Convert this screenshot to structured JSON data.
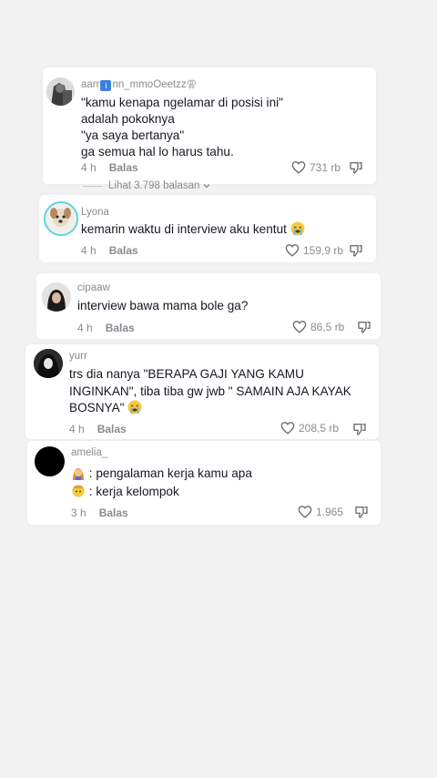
{
  "comments": [
    {
      "username": "aarr",
      "username_rest": "nn_mmoOeetzz",
      "lines": [
        "\"kamu kenapa ngelamar di posisi ini\"",
        "adalah pokoknya",
        "\"ya saya bertanya\"",
        "ga semua hal lo harus tahu."
      ],
      "time": "4 h",
      "reply": "Balas",
      "likes": "731 rb",
      "view_replies": "Lihat 3.798 balasan"
    },
    {
      "username": "Lyona",
      "text": "kemarin waktu di interview aku kentut",
      "time": "4 h",
      "reply": "Balas",
      "likes": "159,9 rb"
    },
    {
      "username": "cipaaw",
      "text": "interview bawa mama bole ga?",
      "time": "4 h",
      "reply": "Balas",
      "likes": "86,5 rb"
    },
    {
      "username": "yurr",
      "lines": [
        "trs dia nanya \"BERAPA GAJI YANG KAMU",
        "INGINKAN\", tiba tiba gw jwb \" SAMAIN AJA KAYAK",
        "BOSNYA\""
      ],
      "time": "4 h",
      "reply": "Balas",
      "likes": "208,5 rb"
    },
    {
      "username": "amelia_",
      "lines": [
        ": pengalaman kerja kamu apa",
        ": kerja kelompok"
      ],
      "time": "3 h",
      "reply": "Balas",
      "likes": "1.965"
    }
  ],
  "colors": {
    "background": "#f2f2f3",
    "card": "#ffffff",
    "text": "#161823",
    "muted": "#8a8b91",
    "avatar_ring": "#58d5e0"
  },
  "icons": [
    "heart-icon",
    "dislike-icon",
    "crying-emoji",
    "chevron-down-icon",
    "info-icon",
    "woman-emoji",
    "person-emoji"
  ]
}
